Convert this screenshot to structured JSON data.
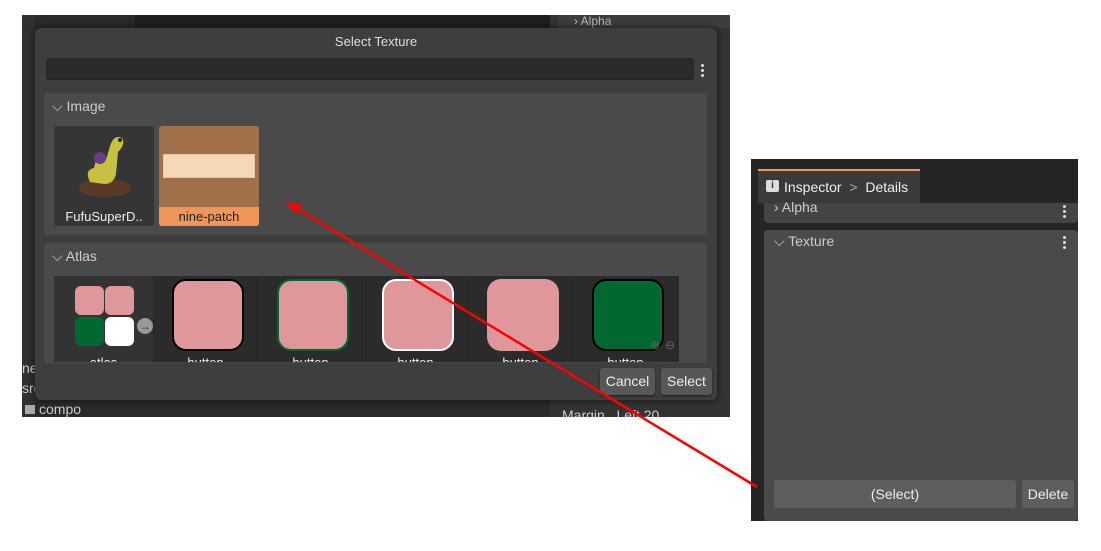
{
  "background": {
    "top_fragment": "Alpha",
    "left_fragments": [
      "nep",
      "sro",
      "compo"
    ],
    "right_fragments": {
      "margin": "Margin",
      "left": "Left",
      "value": "20"
    }
  },
  "dialog": {
    "title": "Select Texture",
    "search": {
      "value": "",
      "placeholder": ""
    },
    "image_section": {
      "title": "Image",
      "items": [
        {
          "label": "FufuSuperD..",
          "selected": false
        },
        {
          "label": "nine-patch",
          "selected": true
        }
      ]
    },
    "atlas_section": {
      "title": "Atlas",
      "items": [
        {
          "label": "atlas"
        },
        {
          "label": "button"
        },
        {
          "label": "button"
        },
        {
          "label": "button"
        },
        {
          "label": "button"
        },
        {
          "label": "button"
        }
      ]
    },
    "cancel_label": "Cancel",
    "select_label": "Select"
  },
  "inspector": {
    "tab_label": "Inspector",
    "breadcrumb_sep": ">",
    "breadcrumb": "Details",
    "alpha_section": "Alpha",
    "texture_section": "Texture",
    "select_button": "(Select)",
    "delete_button": "Delete"
  },
  "colors": {
    "accent": "#f0965a",
    "arrow": "#ff0000",
    "pink": "#e0979c",
    "green": "#006830"
  }
}
